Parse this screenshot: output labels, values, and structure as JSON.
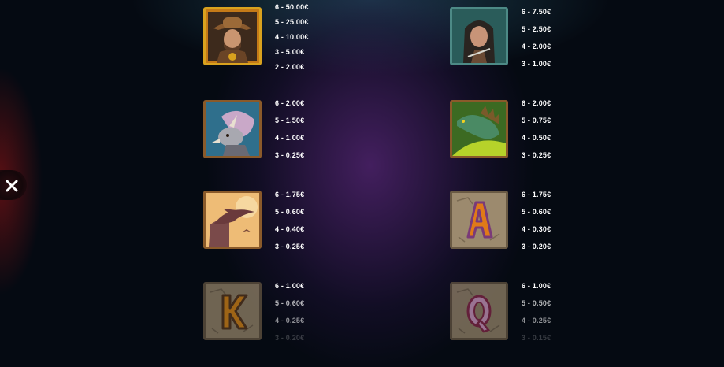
{
  "close_button": {
    "icon": "close-icon"
  },
  "paytable": [
    {
      "symbol": "explorer",
      "pays": [
        "6 - 50.00€",
        "5 - 25.00€",
        "4 - 10.00€",
        "3 - 5.00€",
        "2 - 2.00€"
      ]
    },
    {
      "symbol": "huntress",
      "pays": [
        "6 - 7.50€",
        "5 - 2.50€",
        "4 - 2.00€",
        "3 - 1.00€"
      ]
    },
    {
      "symbol": "triceratops",
      "pays": [
        "6 - 2.00€",
        "5 - 1.50€",
        "4 - 1.00€",
        "3 - 0.25€"
      ]
    },
    {
      "symbol": "stegosaurus",
      "pays": [
        "6 - 2.00€",
        "5 - 0.75€",
        "4 - 0.50€",
        "3 - 0.25€"
      ]
    },
    {
      "symbol": "pterodactyl",
      "pays": [
        "6 - 1.75€",
        "5 - 0.60€",
        "4 - 0.40€",
        "3 - 0.25€"
      ]
    },
    {
      "symbol": "A",
      "pays": [
        "6 - 1.75€",
        "5 - 0.60€",
        "4 - 0.30€",
        "3 - 0.20€"
      ]
    },
    {
      "symbol": "K",
      "pays": [
        "6 - 1.00€",
        "5 - 0.60€",
        "4 - 0.25€",
        "3 - 0.20€"
      ]
    },
    {
      "symbol": "Q",
      "pays": [
        "6 - 1.00€",
        "5 - 0.50€",
        "4 - 0.25€",
        "3 - 0.15€"
      ]
    }
  ],
  "colors": {
    "frame": "#8a5a2a",
    "gold_frame": "#d9a21e",
    "stone": "#9c8a6e",
    "letter_orange": "#e07a18"
  }
}
